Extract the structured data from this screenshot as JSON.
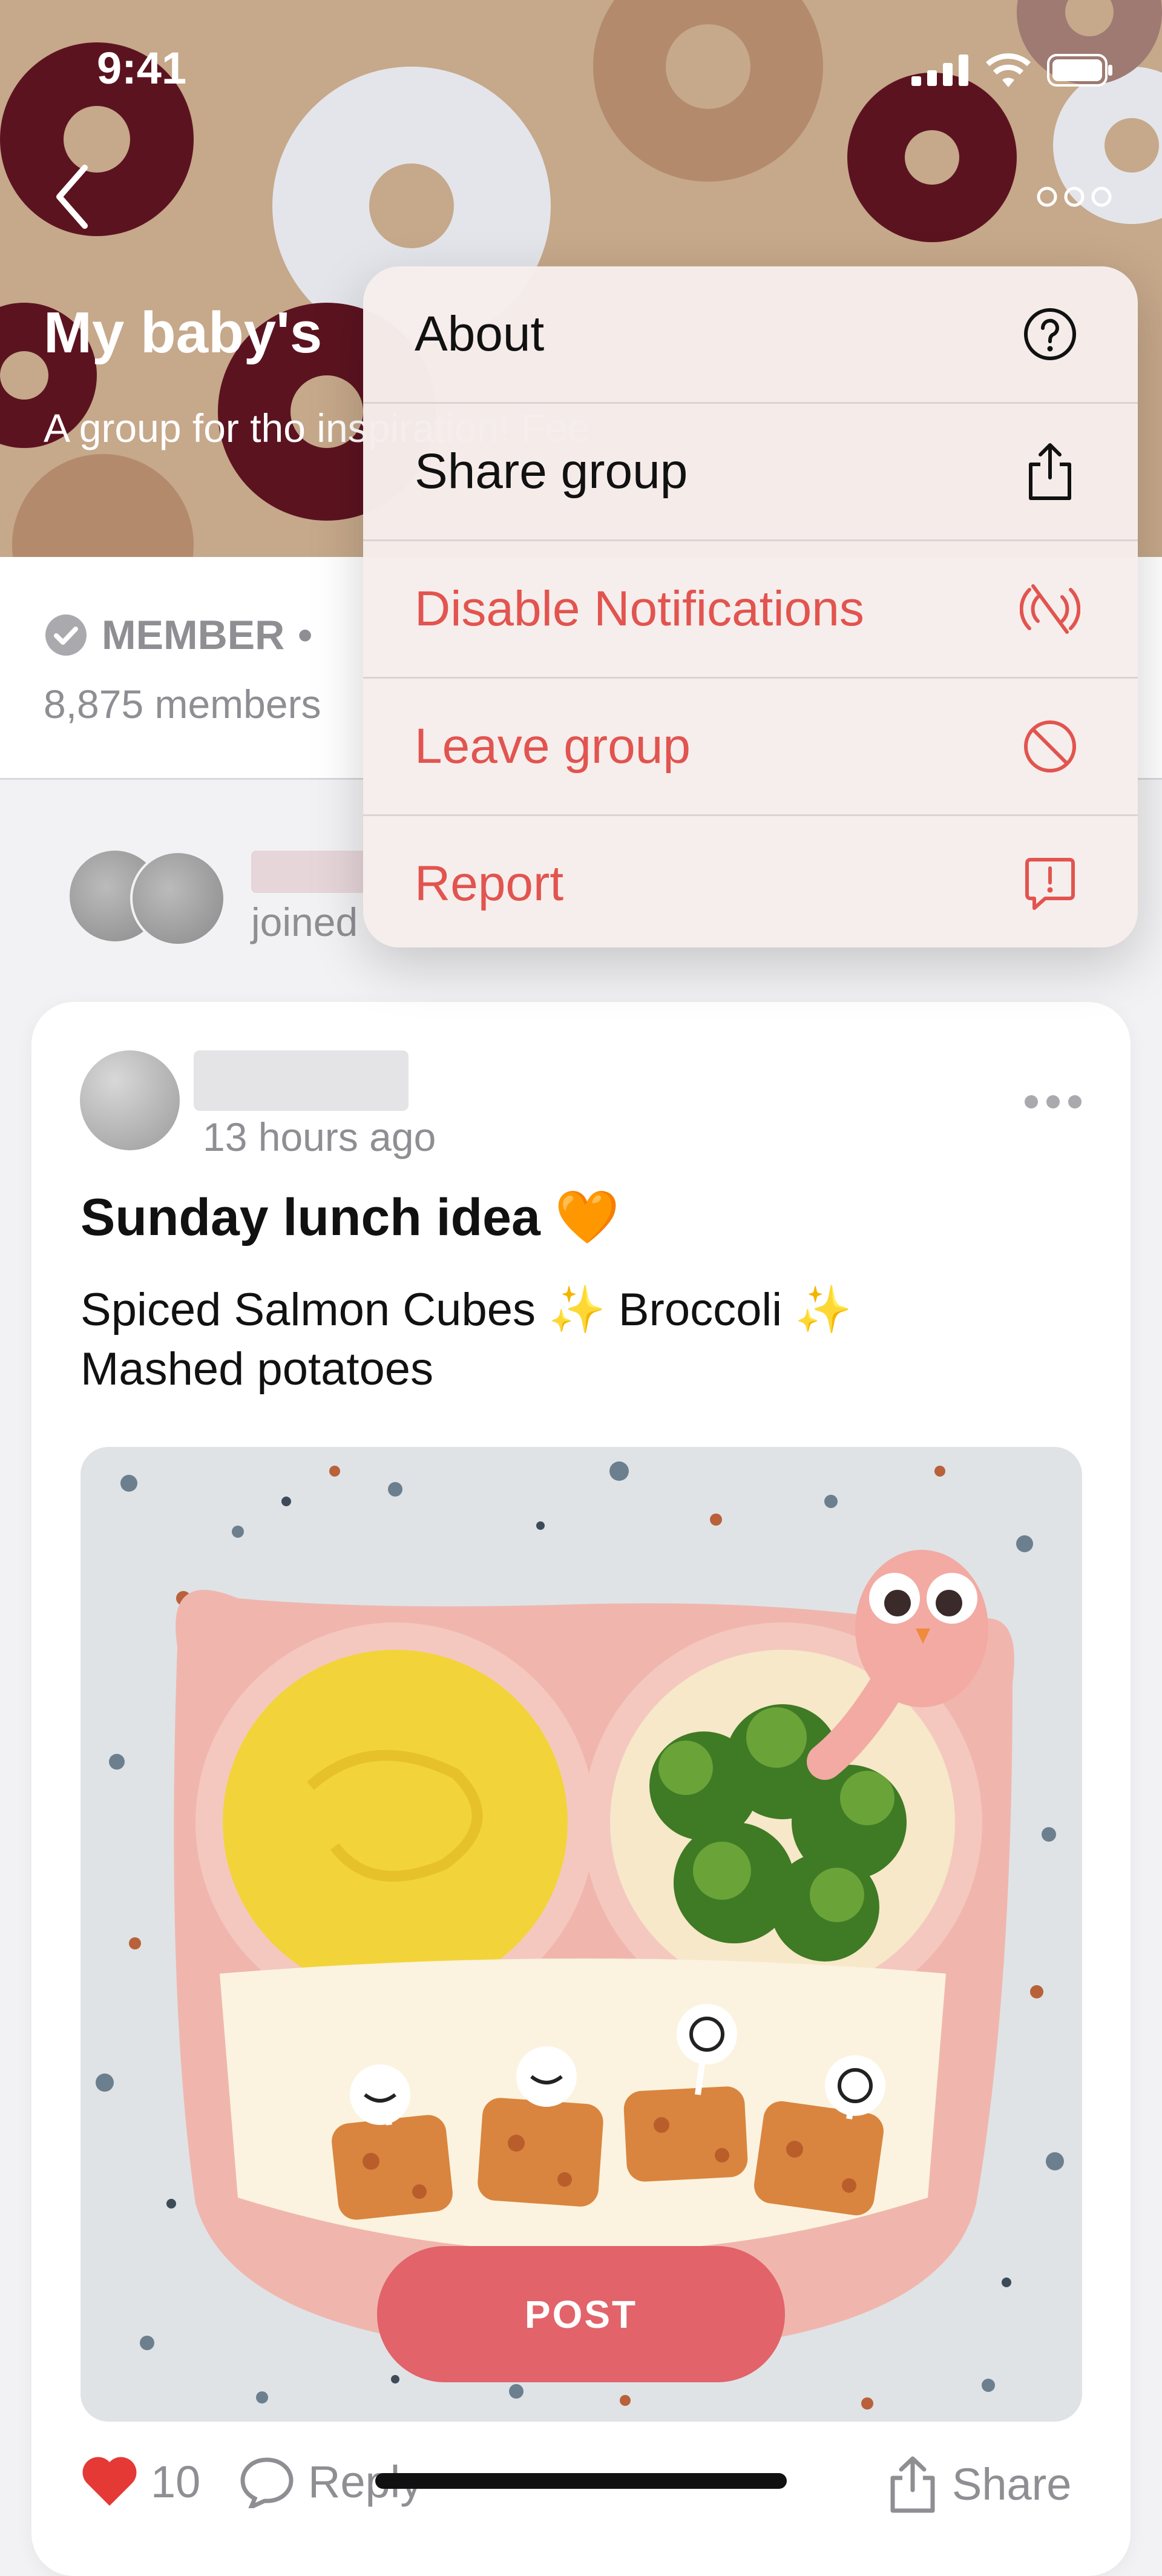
{
  "status_bar": {
    "time": "9:41"
  },
  "group": {
    "title": "My baby's",
    "description": "A group for tho inspiration! Fee",
    "membership_label": "MEMBER",
    "members_count": "8,875 members"
  },
  "joined": {
    "text": "joined"
  },
  "menu": {
    "items": [
      {
        "label": "About",
        "icon": "question-circle-icon",
        "style": "default"
      },
      {
        "label": "Share group",
        "icon": "share-icon",
        "style": "default"
      },
      {
        "label": "Disable Notifications",
        "icon": "notifications-off-icon",
        "style": "destructive"
      },
      {
        "label": "Leave group",
        "icon": "leave-circle-icon",
        "style": "destructive"
      },
      {
        "label": "Report",
        "icon": "report-bubble-icon",
        "style": "destructive"
      }
    ]
  },
  "post": {
    "time": "13 hours ago",
    "title": "Sunday lunch idea 🧡",
    "body_line1": "Spiced Salmon Cubes ✨ Broccoli ✨",
    "body_line2": "Mashed potatoes",
    "image_icon": "food-photo"
  },
  "actions": {
    "like_count": "10",
    "reply_label": "Reply",
    "share_label": "Share"
  },
  "post_button": {
    "label": "POST"
  },
  "colors": {
    "accent": "#e2636a",
    "destructive": "#e2544f",
    "muted": "#8e8e93"
  }
}
